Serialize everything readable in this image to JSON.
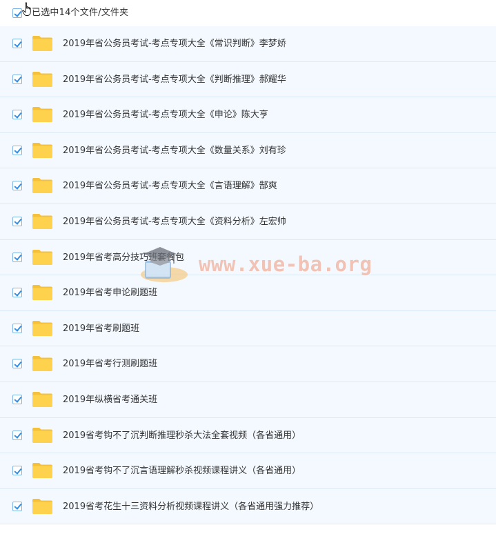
{
  "header": {
    "select_all_label": "已选中14个文件/文件夹"
  },
  "files": [
    {
      "name": "2019年省公务员考试-考点专项大全《常识判断》李梦娇",
      "selected": true,
      "icon": "folder-icon"
    },
    {
      "name": "2019年省公务员考试-考点专项大全《判断推理》郝耀华",
      "selected": true,
      "icon": "folder-icon"
    },
    {
      "name": "2019年省公务员考试-考点专项大全《申论》陈大亨",
      "selected": true,
      "icon": "folder-icon"
    },
    {
      "name": "2019年省公务员考试-考点专项大全《数量关系》刘有珍",
      "selected": true,
      "icon": "folder-icon"
    },
    {
      "name": "2019年省公务员考试-考点专项大全《言语理解》郜爽",
      "selected": true,
      "icon": "folder-icon"
    },
    {
      "name": "2019年省公务员考试-考点专项大全《资料分析》左宏帅",
      "selected": true,
      "icon": "folder-icon"
    },
    {
      "name": "2019年省考高分技巧班套餐包",
      "selected": true,
      "icon": "folder-icon"
    },
    {
      "name": "2019年省考申论刷题班",
      "selected": true,
      "icon": "folder-icon"
    },
    {
      "name": "2019年省考刷题班",
      "selected": true,
      "icon": "folder-icon"
    },
    {
      "name": "2019年省考行测刷题班",
      "selected": true,
      "icon": "folder-icon"
    },
    {
      "name": "2019年纵横省考通关班",
      "selected": true,
      "icon": "folder-icon"
    },
    {
      "name": "2019省考钩不了沉判断推理秒杀大法全套视频（各省通用）",
      "selected": true,
      "icon": "folder-icon"
    },
    {
      "name": "2019省考钩不了沉言语理解秒杀视频课程讲义（各省通用）",
      "selected": true,
      "icon": "folder-icon"
    },
    {
      "name": "2019省考花生十三资料分析视频课程讲义（各省通用强力推荐）",
      "selected": true,
      "icon": "folder-icon"
    }
  ],
  "watermark": {
    "text": "www.xue-ba.org",
    "icon": "graduation-cap-logo"
  },
  "colors": {
    "row_background": "#f3f9ff",
    "row_border": "#dbe9f7",
    "checkbox_check": "#2f8ee5",
    "folder": "#ffd24d",
    "text": "#333333"
  }
}
